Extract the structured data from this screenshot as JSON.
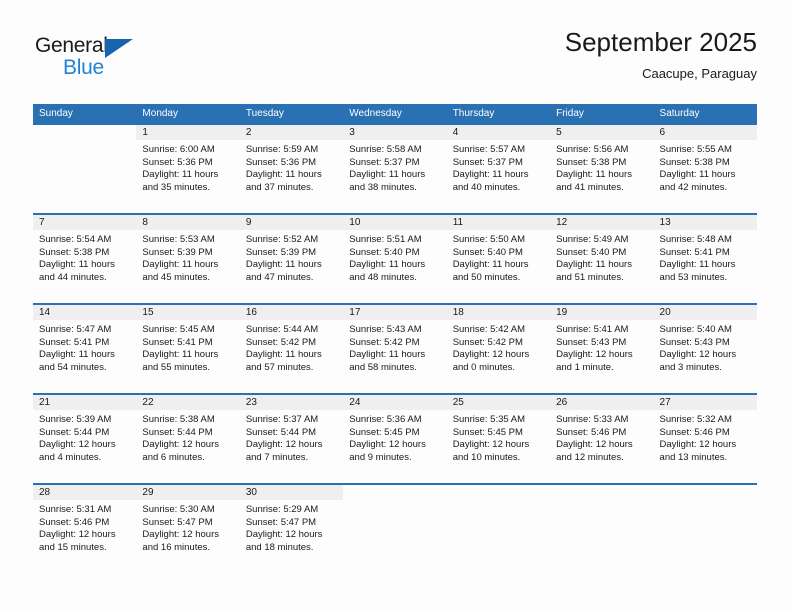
{
  "brand": {
    "line1": "General",
    "line2": "Blue",
    "triangle_color": "#1565ae",
    "blue_color": "#2083d5"
  },
  "header": {
    "month_title": "September 2025",
    "location": "Caacupe, Paraguay"
  },
  "theme": {
    "header_blue": "#2a71b3",
    "daynum_bg": "#efefef",
    "page_bg": "#fdfdfd",
    "text": "#1a1a1a"
  },
  "weekdays": [
    "Sunday",
    "Monday",
    "Tuesday",
    "Wednesday",
    "Thursday",
    "Friday",
    "Saturday"
  ],
  "weeks": [
    [
      {
        "day": "",
        "sunrise": "",
        "sunset": "",
        "daylight1": "",
        "daylight2": ""
      },
      {
        "day": "1",
        "sunrise": "Sunrise: 6:00 AM",
        "sunset": "Sunset: 5:36 PM",
        "daylight1": "Daylight: 11 hours",
        "daylight2": "and 35 minutes."
      },
      {
        "day": "2",
        "sunrise": "Sunrise: 5:59 AM",
        "sunset": "Sunset: 5:36 PM",
        "daylight1": "Daylight: 11 hours",
        "daylight2": "and 37 minutes."
      },
      {
        "day": "3",
        "sunrise": "Sunrise: 5:58 AM",
        "sunset": "Sunset: 5:37 PM",
        "daylight1": "Daylight: 11 hours",
        "daylight2": "and 38 minutes."
      },
      {
        "day": "4",
        "sunrise": "Sunrise: 5:57 AM",
        "sunset": "Sunset: 5:37 PM",
        "daylight1": "Daylight: 11 hours",
        "daylight2": "and 40 minutes."
      },
      {
        "day": "5",
        "sunrise": "Sunrise: 5:56 AM",
        "sunset": "Sunset: 5:38 PM",
        "daylight1": "Daylight: 11 hours",
        "daylight2": "and 41 minutes."
      },
      {
        "day": "6",
        "sunrise": "Sunrise: 5:55 AM",
        "sunset": "Sunset: 5:38 PM",
        "daylight1": "Daylight: 11 hours",
        "daylight2": "and 42 minutes."
      }
    ],
    [
      {
        "day": "7",
        "sunrise": "Sunrise: 5:54 AM",
        "sunset": "Sunset: 5:38 PM",
        "daylight1": "Daylight: 11 hours",
        "daylight2": "and 44 minutes."
      },
      {
        "day": "8",
        "sunrise": "Sunrise: 5:53 AM",
        "sunset": "Sunset: 5:39 PM",
        "daylight1": "Daylight: 11 hours",
        "daylight2": "and 45 minutes."
      },
      {
        "day": "9",
        "sunrise": "Sunrise: 5:52 AM",
        "sunset": "Sunset: 5:39 PM",
        "daylight1": "Daylight: 11 hours",
        "daylight2": "and 47 minutes."
      },
      {
        "day": "10",
        "sunrise": "Sunrise: 5:51 AM",
        "sunset": "Sunset: 5:40 PM",
        "daylight1": "Daylight: 11 hours",
        "daylight2": "and 48 minutes."
      },
      {
        "day": "11",
        "sunrise": "Sunrise: 5:50 AM",
        "sunset": "Sunset: 5:40 PM",
        "daylight1": "Daylight: 11 hours",
        "daylight2": "and 50 minutes."
      },
      {
        "day": "12",
        "sunrise": "Sunrise: 5:49 AM",
        "sunset": "Sunset: 5:40 PM",
        "daylight1": "Daylight: 11 hours",
        "daylight2": "and 51 minutes."
      },
      {
        "day": "13",
        "sunrise": "Sunrise: 5:48 AM",
        "sunset": "Sunset: 5:41 PM",
        "daylight1": "Daylight: 11 hours",
        "daylight2": "and 53 minutes."
      }
    ],
    [
      {
        "day": "14",
        "sunrise": "Sunrise: 5:47 AM",
        "sunset": "Sunset: 5:41 PM",
        "daylight1": "Daylight: 11 hours",
        "daylight2": "and 54 minutes."
      },
      {
        "day": "15",
        "sunrise": "Sunrise: 5:45 AM",
        "sunset": "Sunset: 5:41 PM",
        "daylight1": "Daylight: 11 hours",
        "daylight2": "and 55 minutes."
      },
      {
        "day": "16",
        "sunrise": "Sunrise: 5:44 AM",
        "sunset": "Sunset: 5:42 PM",
        "daylight1": "Daylight: 11 hours",
        "daylight2": "and 57 minutes."
      },
      {
        "day": "17",
        "sunrise": "Sunrise: 5:43 AM",
        "sunset": "Sunset: 5:42 PM",
        "daylight1": "Daylight: 11 hours",
        "daylight2": "and 58 minutes."
      },
      {
        "day": "18",
        "sunrise": "Sunrise: 5:42 AM",
        "sunset": "Sunset: 5:42 PM",
        "daylight1": "Daylight: 12 hours",
        "daylight2": "and 0 minutes."
      },
      {
        "day": "19",
        "sunrise": "Sunrise: 5:41 AM",
        "sunset": "Sunset: 5:43 PM",
        "daylight1": "Daylight: 12 hours",
        "daylight2": "and 1 minute."
      },
      {
        "day": "20",
        "sunrise": "Sunrise: 5:40 AM",
        "sunset": "Sunset: 5:43 PM",
        "daylight1": "Daylight: 12 hours",
        "daylight2": "and 3 minutes."
      }
    ],
    [
      {
        "day": "21",
        "sunrise": "Sunrise: 5:39 AM",
        "sunset": "Sunset: 5:44 PM",
        "daylight1": "Daylight: 12 hours",
        "daylight2": "and 4 minutes."
      },
      {
        "day": "22",
        "sunrise": "Sunrise: 5:38 AM",
        "sunset": "Sunset: 5:44 PM",
        "daylight1": "Daylight: 12 hours",
        "daylight2": "and 6 minutes."
      },
      {
        "day": "23",
        "sunrise": "Sunrise: 5:37 AM",
        "sunset": "Sunset: 5:44 PM",
        "daylight1": "Daylight: 12 hours",
        "daylight2": "and 7 minutes."
      },
      {
        "day": "24",
        "sunrise": "Sunrise: 5:36 AM",
        "sunset": "Sunset: 5:45 PM",
        "daylight1": "Daylight: 12 hours",
        "daylight2": "and 9 minutes."
      },
      {
        "day": "25",
        "sunrise": "Sunrise: 5:35 AM",
        "sunset": "Sunset: 5:45 PM",
        "daylight1": "Daylight: 12 hours",
        "daylight2": "and 10 minutes."
      },
      {
        "day": "26",
        "sunrise": "Sunrise: 5:33 AM",
        "sunset": "Sunset: 5:46 PM",
        "daylight1": "Daylight: 12 hours",
        "daylight2": "and 12 minutes."
      },
      {
        "day": "27",
        "sunrise": "Sunrise: 5:32 AM",
        "sunset": "Sunset: 5:46 PM",
        "daylight1": "Daylight: 12 hours",
        "daylight2": "and 13 minutes."
      }
    ],
    [
      {
        "day": "28",
        "sunrise": "Sunrise: 5:31 AM",
        "sunset": "Sunset: 5:46 PM",
        "daylight1": "Daylight: 12 hours",
        "daylight2": "and 15 minutes."
      },
      {
        "day": "29",
        "sunrise": "Sunrise: 5:30 AM",
        "sunset": "Sunset: 5:47 PM",
        "daylight1": "Daylight: 12 hours",
        "daylight2": "and 16 minutes."
      },
      {
        "day": "30",
        "sunrise": "Sunrise: 5:29 AM",
        "sunset": "Sunset: 5:47 PM",
        "daylight1": "Daylight: 12 hours",
        "daylight2": "and 18 minutes."
      },
      {
        "day": "",
        "sunrise": "",
        "sunset": "",
        "daylight1": "",
        "daylight2": ""
      },
      {
        "day": "",
        "sunrise": "",
        "sunset": "",
        "daylight1": "",
        "daylight2": ""
      },
      {
        "day": "",
        "sunrise": "",
        "sunset": "",
        "daylight1": "",
        "daylight2": ""
      },
      {
        "day": "",
        "sunrise": "",
        "sunset": "",
        "daylight1": "",
        "daylight2": ""
      }
    ]
  ]
}
